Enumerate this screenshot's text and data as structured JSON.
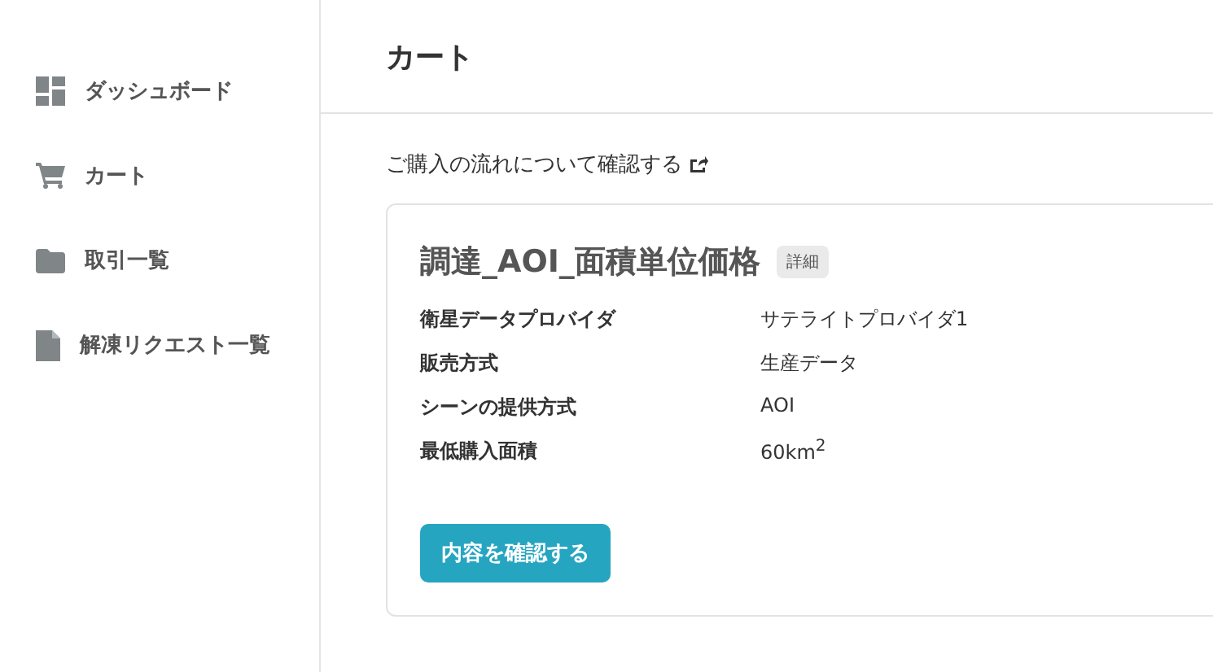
{
  "sidebar": {
    "items": [
      {
        "label": "ダッシュボード"
      },
      {
        "label": "カート"
      },
      {
        "label": "取引一覧"
      },
      {
        "label": "解凍リクエスト一覧"
      }
    ]
  },
  "header": {
    "title": "カート"
  },
  "guide_link": "ご購入の流れについて確認する",
  "card": {
    "title": "調達_AOI_面積単位価格",
    "badge": "詳細",
    "rows": [
      {
        "label": "衛星データプロバイダ",
        "value": "サテライトプロバイダ1"
      },
      {
        "label": "販売方式",
        "value": "生産データ"
      },
      {
        "label": "シーンの提供方式",
        "value": "AOI"
      },
      {
        "label": "最低購入面積",
        "value": "60km$^{2}$"
      }
    ],
    "button": "内容を確認する"
  }
}
